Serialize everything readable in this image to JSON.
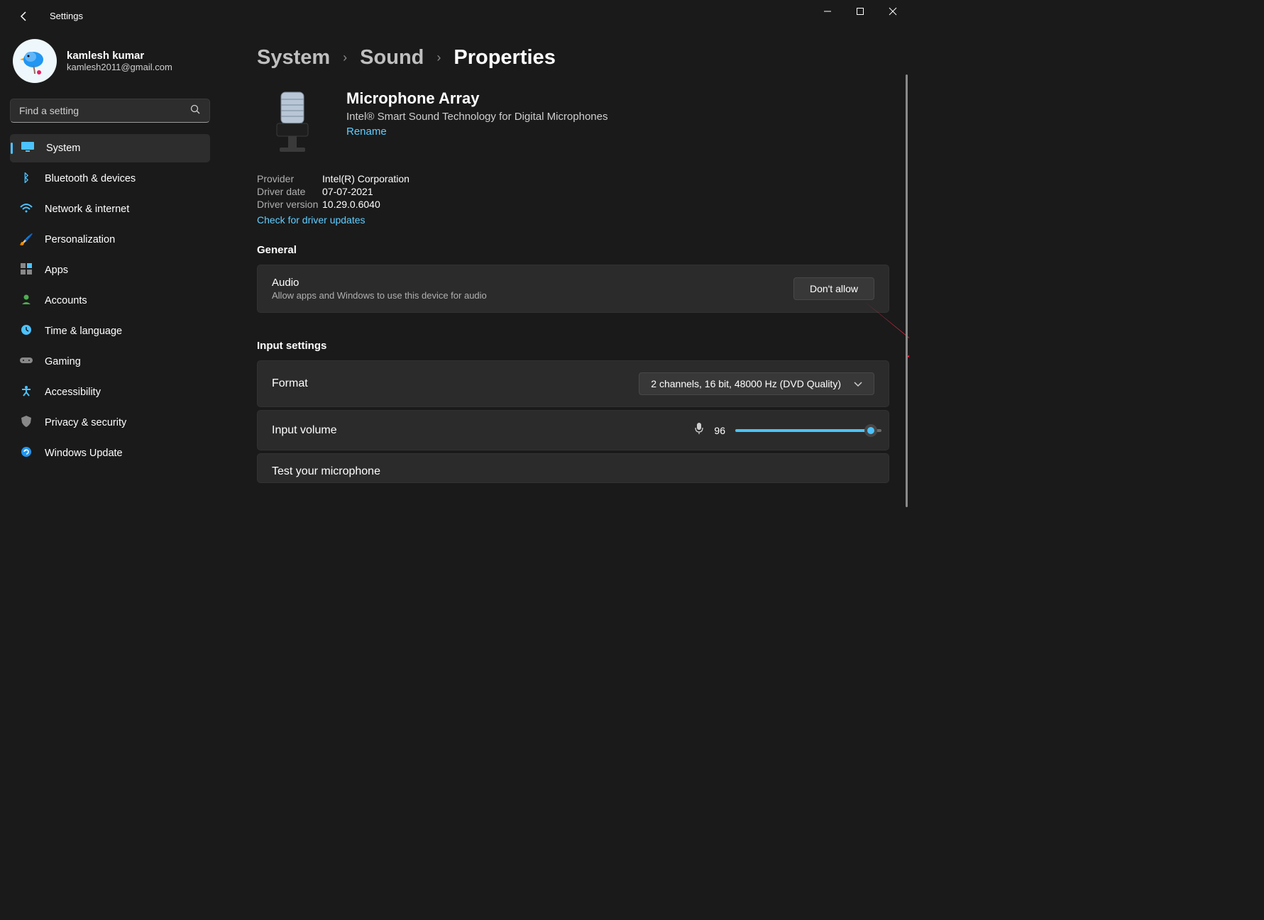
{
  "app": {
    "title": "Settings"
  },
  "profile": {
    "name": "kamlesh kumar",
    "email": "kamlesh2011@gmail.com"
  },
  "search": {
    "placeholder": "Find a setting"
  },
  "nav": [
    {
      "icon": "🖥️",
      "label": "System",
      "active": true
    },
    {
      "icon": "ᛒ",
      "label": "Bluetooth & devices"
    },
    {
      "icon": "📶",
      "label": "Network & internet"
    },
    {
      "icon": "🖌️",
      "label": "Personalization"
    },
    {
      "icon": "▦",
      "label": "Apps"
    },
    {
      "icon": "👤",
      "label": "Accounts"
    },
    {
      "icon": "🕒",
      "label": "Time & language"
    },
    {
      "icon": "🎮",
      "label": "Gaming"
    },
    {
      "icon": "✖",
      "label": "Accessibility",
      "accessibility": true
    },
    {
      "icon": "🛡️",
      "label": "Privacy & security"
    },
    {
      "icon": "🔄",
      "label": "Windows Update"
    }
  ],
  "breadcrumb": [
    "System",
    "Sound",
    "Properties"
  ],
  "device": {
    "name": "Microphone Array",
    "description": "Intel® Smart Sound Technology for Digital Microphones",
    "rename_label": "Rename"
  },
  "info": {
    "provider_label": "Provider",
    "provider_value": "Intel(R) Corporation",
    "driver_date_label": "Driver date",
    "driver_date_value": "07-07-2021",
    "driver_version_label": "Driver version",
    "driver_version_value": "10.29.0.6040",
    "check_updates_label": "Check for driver updates"
  },
  "sections": {
    "general_title": "General",
    "audio_title": "Audio",
    "audio_sub": "Allow apps and Windows to use this device for audio",
    "dont_allow_label": "Don't allow",
    "input_settings_title": "Input settings",
    "format_label": "Format",
    "format_value": "2 channels, 16 bit, 48000 Hz (DVD Quality)",
    "input_volume_label": "Input volume",
    "input_volume_value": "96",
    "test_mic_label": "Test your microphone"
  }
}
